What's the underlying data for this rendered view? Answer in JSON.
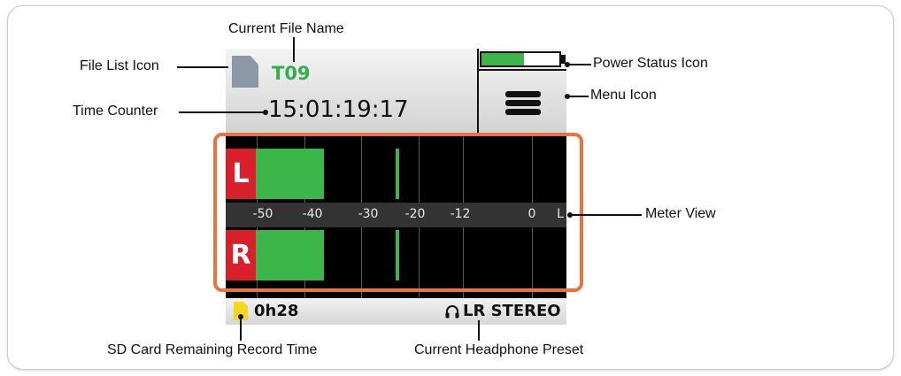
{
  "device": {
    "file_name": "T09",
    "time_counter": "15:01:19:17",
    "battery_level": 0.55,
    "sd_remaining": "0h28",
    "headphone_preset": "LR STEREO"
  },
  "meter": {
    "scale_labels": [
      "-50",
      "-40",
      "-30",
      "-20",
      "-12",
      "0",
      "L"
    ],
    "channels": [
      {
        "label": "L",
        "level_db": -38,
        "peak_db": -22
      },
      {
        "label": "R",
        "level_db": -38,
        "peak_db": -22
      }
    ]
  },
  "callouts": {
    "file_list_icon": "File List Icon",
    "current_file_name": "Current File Name",
    "time_counter": "Time Counter",
    "power_status_icon": "Power Status Icon",
    "menu_icon": "Menu Icon",
    "meter_view": "Meter View",
    "sd_card_remaining": "SD Card Remaining Record Time",
    "current_headphone_preset": "Current Headphone Preset"
  },
  "colors": {
    "accent_green": "#3bb64a",
    "channel_red": "#d9202a",
    "highlight_orange": "#e8743b",
    "sd_yellow": "#f4d81d"
  }
}
